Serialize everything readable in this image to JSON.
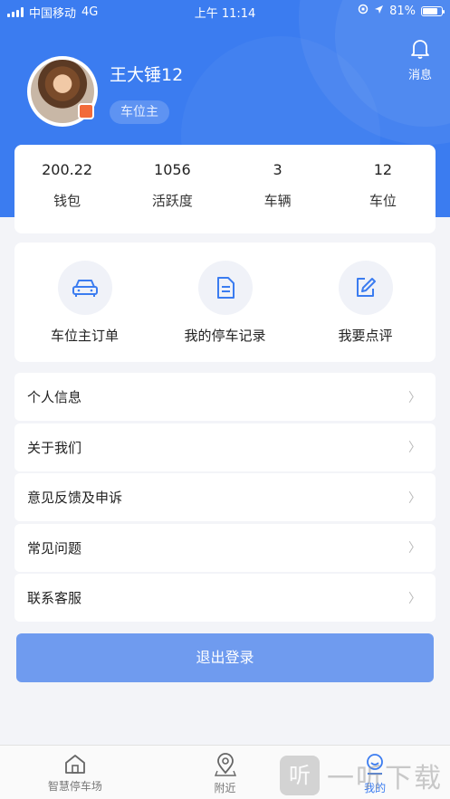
{
  "status_bar": {
    "carrier": "中国移动",
    "network": "4G",
    "time": "上午 11:14",
    "battery": "81%"
  },
  "header": {
    "message_label": "消息",
    "username": "王大锤12",
    "role": "车位主"
  },
  "stats": [
    {
      "value": "200.22",
      "label": "钱包"
    },
    {
      "value": "1056",
      "label": "活跃度"
    },
    {
      "value": "3",
      "label": "车辆"
    },
    {
      "value": "12",
      "label": "车位"
    }
  ],
  "actions": [
    {
      "label": "车位主订单",
      "icon": "car-icon"
    },
    {
      "label": "我的停车记录",
      "icon": "document-icon"
    },
    {
      "label": "我要点评",
      "icon": "edit-icon"
    }
  ],
  "menu": [
    {
      "label": "个人信息"
    },
    {
      "label": "关于我们"
    },
    {
      "label": "意见反馈及申诉"
    },
    {
      "label": "常见问题"
    },
    {
      "label": "联系客服"
    }
  ],
  "logout_label": "退出登录",
  "tabs": [
    {
      "label": "智慧停车场",
      "icon": "home-icon"
    },
    {
      "label": "附近",
      "icon": "location-icon"
    },
    {
      "label": "我的",
      "icon": "profile-icon"
    }
  ],
  "watermark": {
    "logo": "听",
    "text": "一听下载"
  },
  "colors": {
    "primary": "#3b7cf0",
    "logout": "#6f9bef",
    "background": "#f3f4f8"
  }
}
